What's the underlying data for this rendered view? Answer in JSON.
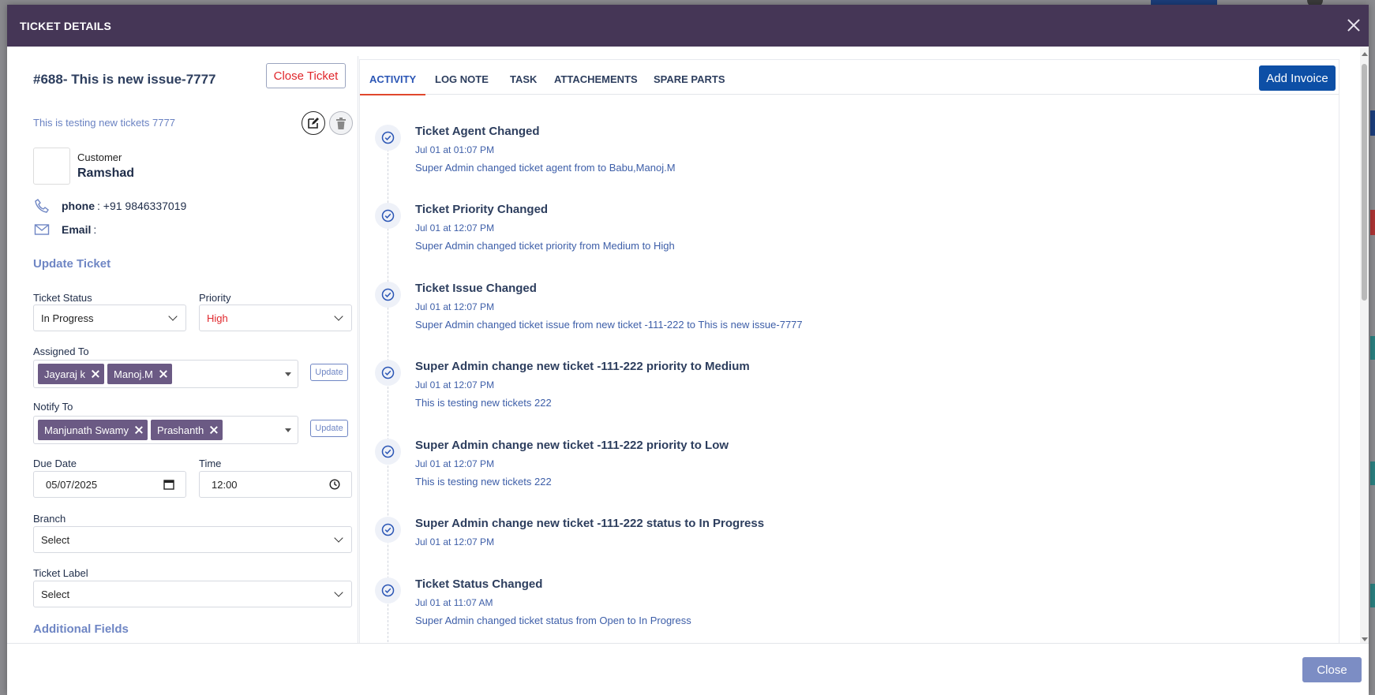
{
  "modal": {
    "title": "TICKET DETAILS"
  },
  "ticket": {
    "title": "#688- This is new issue-7777",
    "close_label": "Close Ticket",
    "description": "This is testing new tickets 7777"
  },
  "customer": {
    "label": "Customer",
    "name": "Ramshad",
    "phone_label": "phone",
    "phone_value": ": +91 9846337019",
    "email_label": "Email",
    "email_value": ":"
  },
  "update": {
    "heading": "Update Ticket",
    "status_label": "Ticket Status",
    "status_value": "In Progress",
    "priority_label": "Priority",
    "priority_value": "High",
    "assigned_label": "Assigned To",
    "assigned": [
      "Jayaraj k",
      "Manoj.M"
    ],
    "notify_label": "Notify To",
    "notify": [
      "Manjunath Swamy",
      "Prashanth"
    ],
    "update_btn": "Update",
    "due_label": "Due Date",
    "due_value": "05/07/2025",
    "time_label": "Time",
    "time_value": "12:00",
    "branch_label": "Branch",
    "branch_value": "Select",
    "label_label": "Ticket Label",
    "label_value": "Select",
    "additional": "Additional Fields"
  },
  "tabs": [
    "ACTIVITY",
    "LOG NOTE",
    "TASK",
    "ATTACHEMENTS",
    "SPARE PARTS"
  ],
  "add_invoice": "Add Invoice",
  "activities": [
    {
      "title": "Ticket Agent Changed",
      "time": "Jul 01 at 01:07 PM",
      "desc": "Super Admin changed ticket agent from to Babu,Manoj.M"
    },
    {
      "title": "Ticket Priority Changed",
      "time": "Jul 01 at 12:07 PM",
      "desc": "Super Admin changed ticket priority from Medium to High"
    },
    {
      "title": "Ticket Issue Changed",
      "time": "Jul 01 at 12:07 PM",
      "desc": "Super Admin changed ticket issue from new ticket -111-222 to This is new issue-7777"
    },
    {
      "title": "Super Admin change new ticket -111-222 priority to Medium",
      "time": "Jul 01 at 12:07 PM",
      "desc": "This is testing new tickets 222"
    },
    {
      "title": "Super Admin change new ticket -111-222 priority to Low",
      "time": "Jul 01 at 12:07 PM",
      "desc": "This is testing new tickets 222"
    },
    {
      "title": "Super Admin change new ticket -111-222 status to In Progress",
      "time": "Jul 01 at 12:07 PM",
      "desc": ""
    },
    {
      "title": "Ticket Status Changed",
      "time": "Jul 01 at 11:07 AM",
      "desc": "Super Admin changed ticket status from Open to In Progress"
    }
  ],
  "footer": {
    "close_label": "Close"
  },
  "colors": {
    "header": "#453656",
    "accent": "#0d4fa6",
    "chip": "#6b5a84",
    "danger": "#e0272c"
  }
}
